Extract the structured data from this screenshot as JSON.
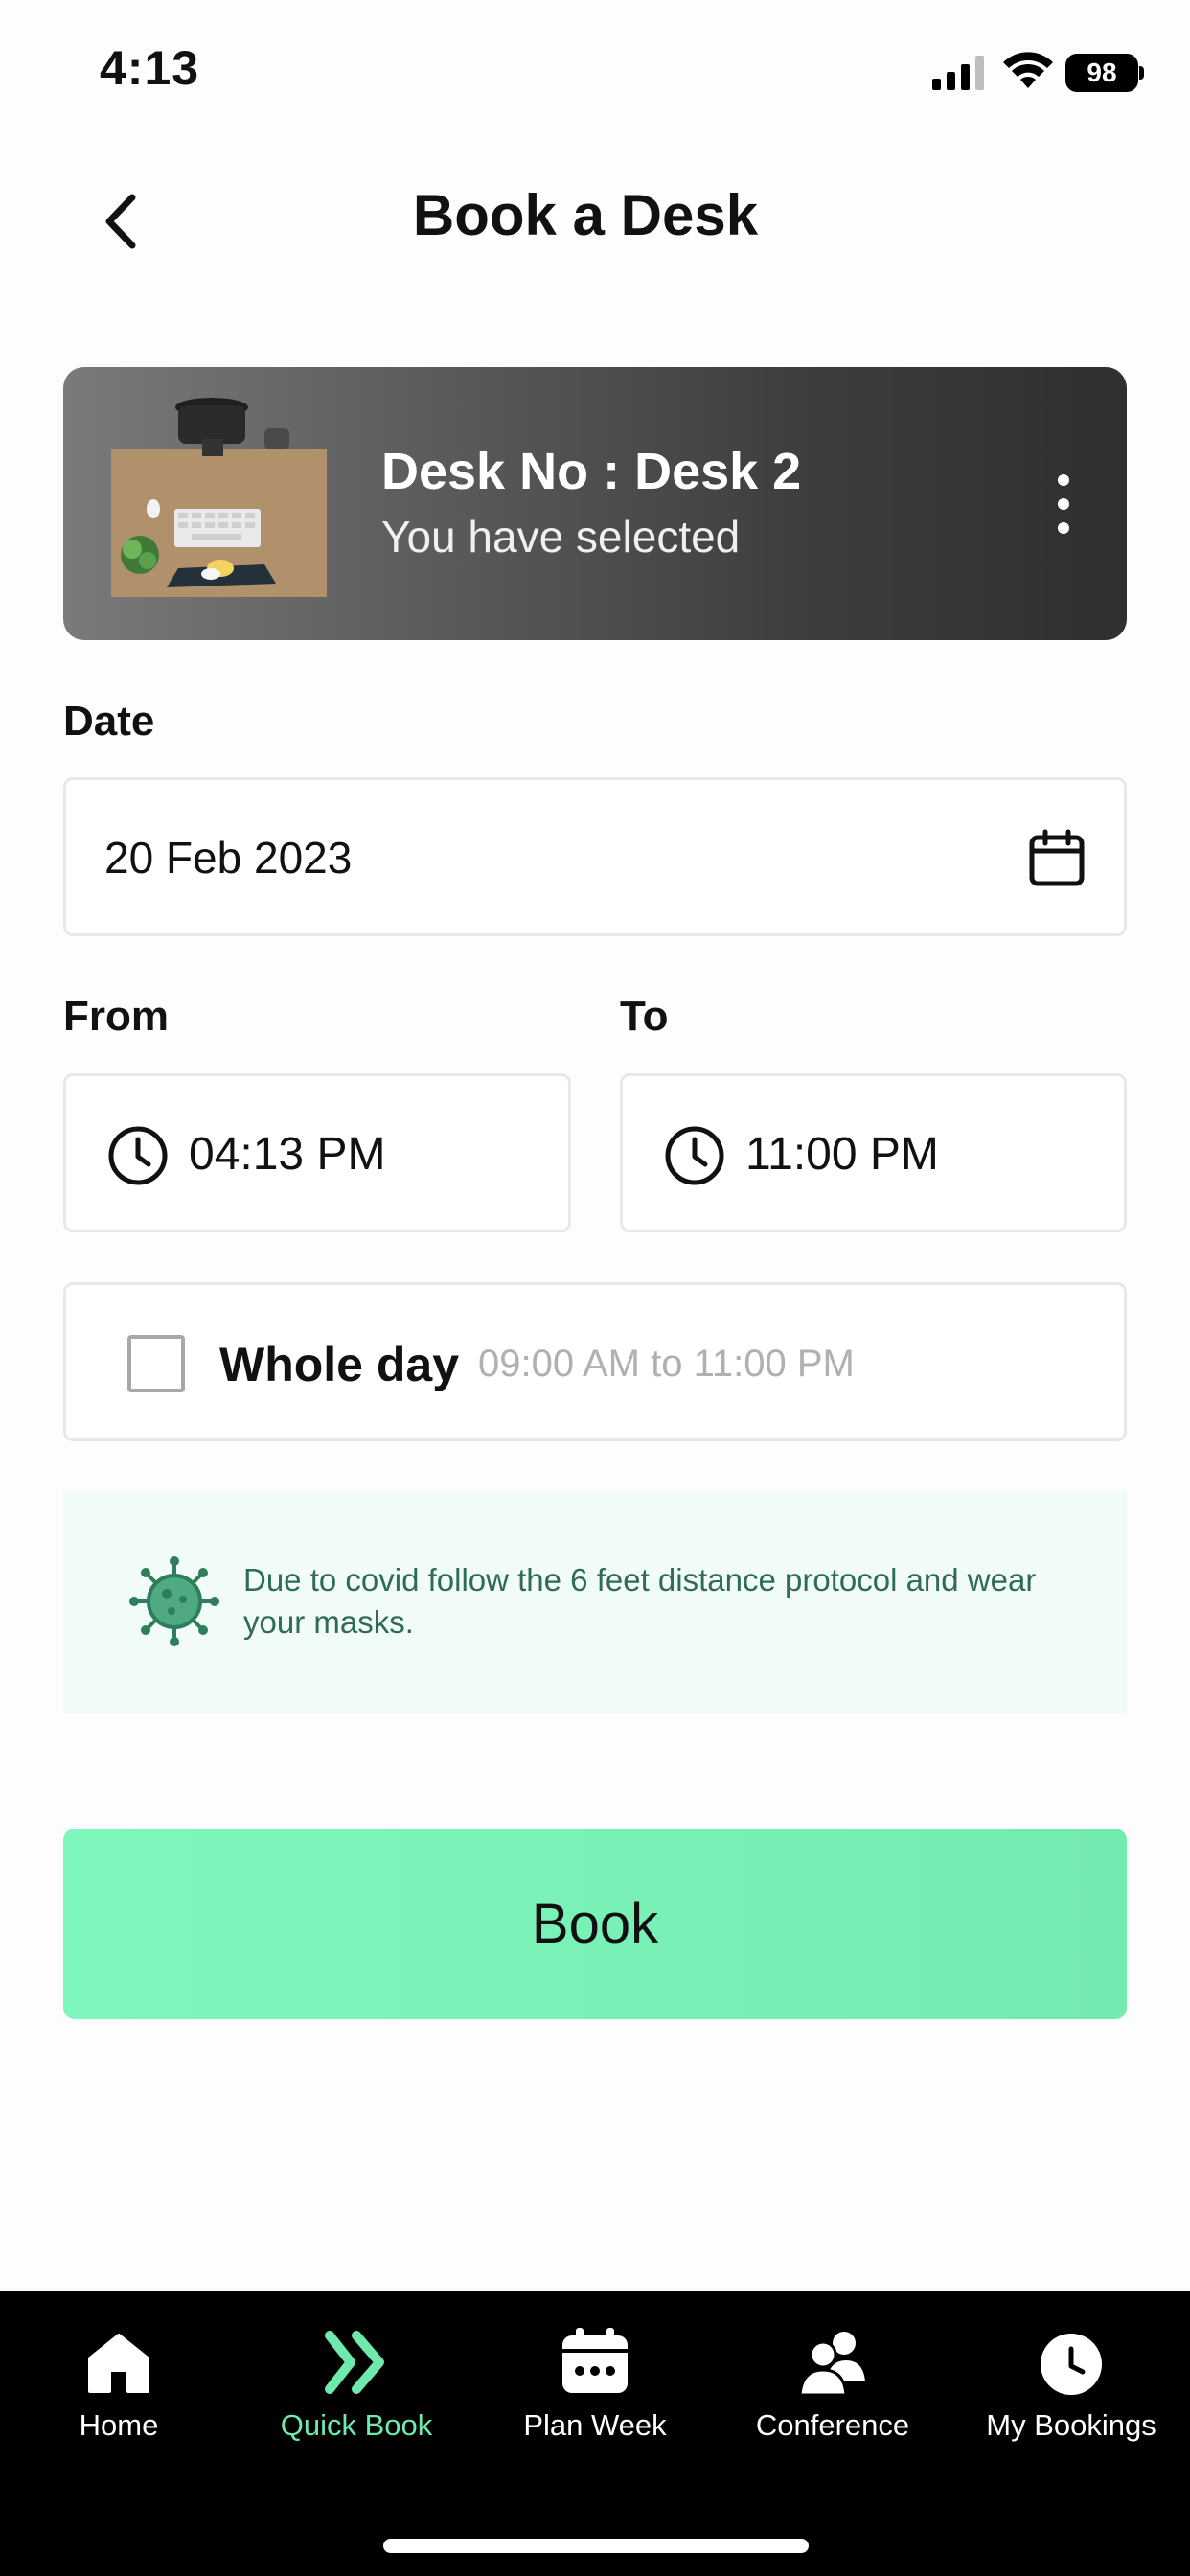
{
  "status_bar": {
    "time": "4:13",
    "battery": "98"
  },
  "header": {
    "title": "Book a Desk"
  },
  "desk_card": {
    "title": "Desk No : Desk 2",
    "subtitle": "You have selected"
  },
  "form": {
    "date_label": "Date",
    "date_value": "20 Feb 2023",
    "from_label": "From",
    "from_value": "04:13 PM",
    "to_label": "To",
    "to_value": "11:00 PM",
    "whole_day_label": "Whole day",
    "whole_day_range": "09:00 AM to 11:00 PM",
    "whole_day_checked": false
  },
  "notice": {
    "text": "Due to covid follow the 6 feet distance protocol and wear your masks."
  },
  "book_button": {
    "label": "Book"
  },
  "colors": {
    "accent": "#6fe9ae",
    "button": "#7ef7bd",
    "notice_bg": "#f1fbf7",
    "notice_text": "#2f6b55"
  },
  "tab_bar": {
    "tabs": [
      {
        "label": "Home",
        "icon": "home-icon",
        "active": false
      },
      {
        "label": "Quick Book",
        "icon": "double-chevron-icon",
        "active": true
      },
      {
        "label": "Plan Week",
        "icon": "calendar-icon",
        "active": false
      },
      {
        "label": "Conference",
        "icon": "people-icon",
        "active": false
      },
      {
        "label": "My Bookings",
        "icon": "clock-badge-icon",
        "active": false
      }
    ]
  }
}
